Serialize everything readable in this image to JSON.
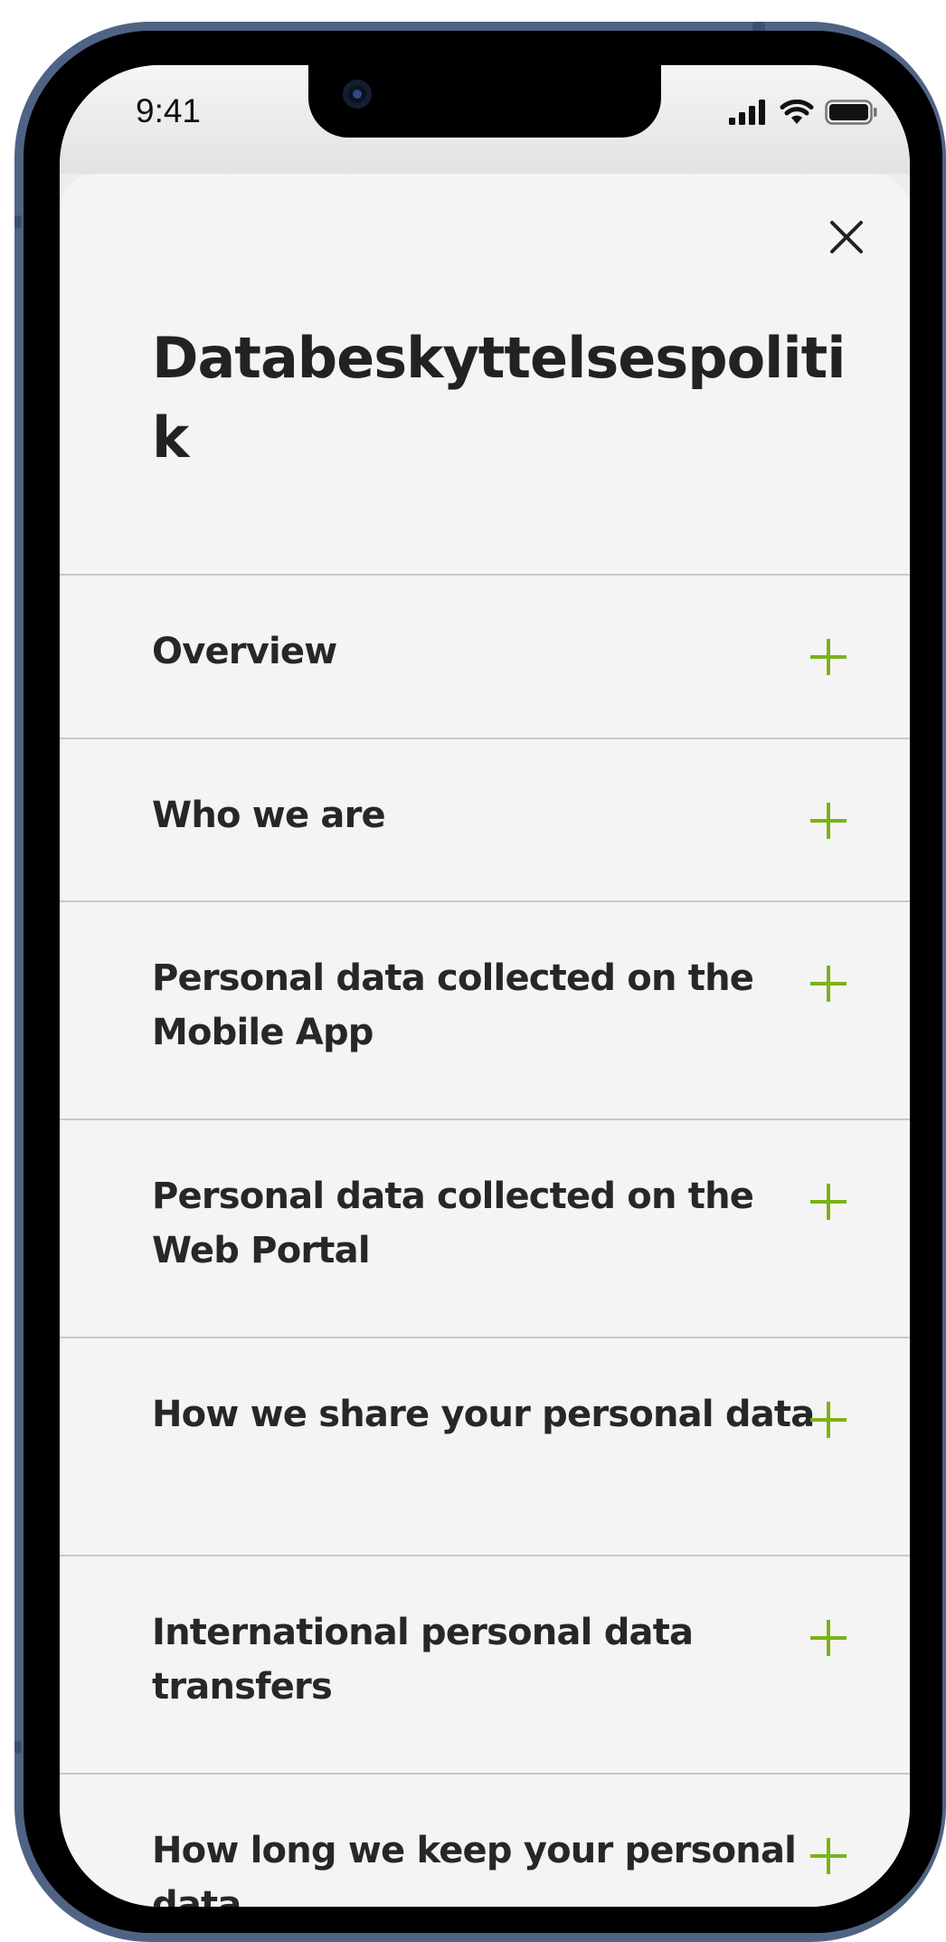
{
  "status_bar": {
    "time": "9:41",
    "signal_icon": "cellular-signal-icon",
    "wifi_icon": "wifi-icon",
    "battery_icon": "battery-icon"
  },
  "sheet": {
    "title": "Databeskyttelsespolitik",
    "close_icon": "close-icon",
    "expand_icon": "plus-icon",
    "accent_color": "#7ab317",
    "items": [
      {
        "label": "Overview"
      },
      {
        "label": "Who we are"
      },
      {
        "label": "Personal data collected on the Mobile App"
      },
      {
        "label": "Personal data collected on the Web Portal"
      },
      {
        "label": "How we share your personal data"
      },
      {
        "label": "International personal data transfers"
      },
      {
        "label": "How long we keep your personal data"
      }
    ]
  }
}
